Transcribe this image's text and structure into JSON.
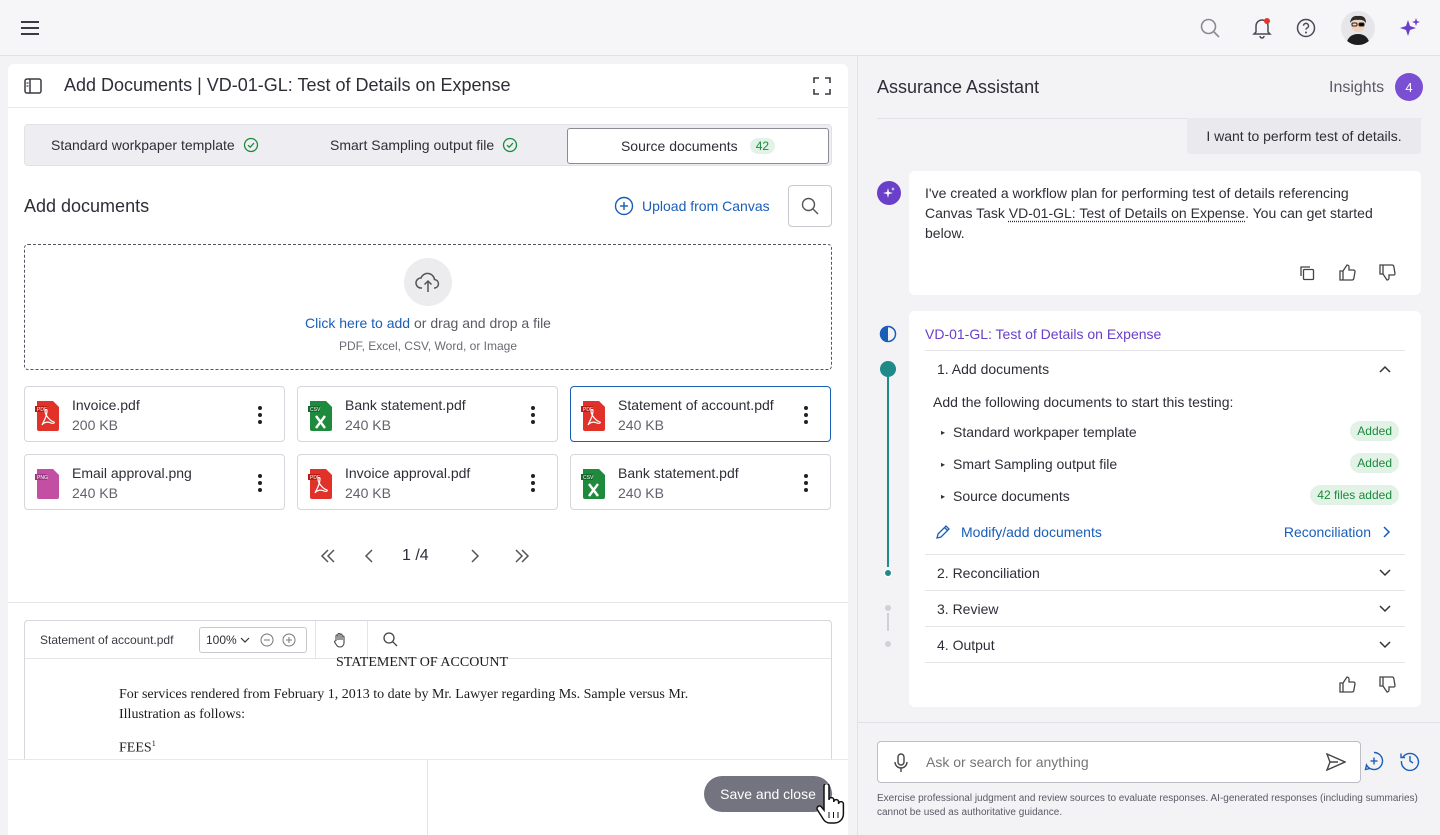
{
  "topbar": {
    "menu_icon": "hamburger-icon",
    "icons": [
      "search-icon",
      "bell-icon",
      "help-icon",
      "avatar",
      "sparkle-icon"
    ]
  },
  "left": {
    "title": "Add Documents | VD-01-GL: Test of Details on Expense",
    "tabs": [
      {
        "label": "Standard workpaper template"
      },
      {
        "label": "Smart Sampling output file"
      },
      {
        "label": "Source documents",
        "badge": "42"
      }
    ],
    "section_title": "Add documents",
    "upload_canvas": "Upload from Canvas",
    "dropzone": {
      "link": "Click here to add",
      "text": "or drag and drop a file",
      "hint": "PDF, Excel, CSV, Word, or Image"
    },
    "files": [
      {
        "name": "Invoice.pdf",
        "size": "200 KB",
        "type": "pdf"
      },
      {
        "name": "Bank statement.pdf",
        "size": "240 KB",
        "type": "csv"
      },
      {
        "name": "Statement of account.pdf",
        "size": "240 KB",
        "type": "pdf"
      },
      {
        "name": "Email approval.png",
        "size": "240 KB",
        "type": "png"
      },
      {
        "name": "Invoice approval.pdf",
        "size": "240 KB",
        "type": "pdf"
      },
      {
        "name": "Bank statement.pdf",
        "size": "240 KB",
        "type": "csv"
      }
    ],
    "pagination": {
      "label": "1 /4"
    },
    "viewer": {
      "file": "Statement of account.pdf",
      "zoom": "100%",
      "doc_title": "STATEMENT OF ACCOUNT",
      "doc_line1": "For services rendered from February 1, 2013 to date by Mr. Lawyer regarding Ms. Sample versus Mr.",
      "doc_line2": "Illustration as follows:",
      "doc_fees": "FEES",
      "doc_fees_sup": "1"
    },
    "save_label": "Save and close"
  },
  "right": {
    "title": "Assurance Assistant",
    "insights_label": "Insights",
    "insights_count": "4",
    "user_msg": "I want to perform test of details.",
    "ai_msg_a": "I've created a workflow plan for performing test of details referencing Canvas Task ",
    "ai_msg_task": "VD-01-GL: Test of Details on Expense",
    "ai_msg_b": ". You can get started below.",
    "workflow": {
      "title": "VD-01-GL: Test of Details on Expense",
      "step1": "1.  Add documents",
      "step1_desc": "Add the following documents to start this testing:",
      "items": [
        {
          "label": "Standard workpaper template",
          "status": "Added"
        },
        {
          "label": "Smart Sampling output file",
          "status": "Added"
        },
        {
          "label": "Source documents",
          "status": "42 files added"
        }
      ],
      "modify": "Modify/add documents",
      "next": "Reconciliation",
      "step2": "2. Reconciliation",
      "step3": "3. Review",
      "step4": "4. Output"
    },
    "composer_placeholder": "Ask or search for anything",
    "disclaimer": "Exercise professional judgment and review sources to evaluate responses. AI-generated responses (including summaries) cannot be used as authoritative guidance."
  },
  "colors": {
    "accent_blue": "#1a5eb8",
    "accent_purple": "#6a3fc9",
    "teal": "#1f8a87",
    "success": "#188b3b"
  }
}
